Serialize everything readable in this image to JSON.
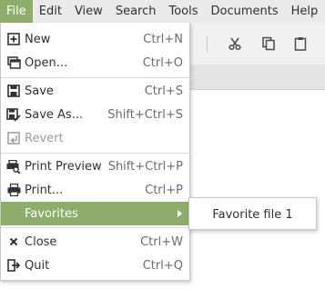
{
  "menubar": {
    "items": [
      {
        "label": "File",
        "active": true
      },
      {
        "label": "Edit"
      },
      {
        "label": "View"
      },
      {
        "label": "Search"
      },
      {
        "label": "Tools"
      },
      {
        "label": "Documents"
      },
      {
        "label": "Help"
      }
    ]
  },
  "toolbar": {
    "icons": [
      "cut-icon",
      "copy-icon",
      "paste-icon"
    ]
  },
  "file_menu": {
    "items": [
      {
        "label": "New",
        "accel": "Ctrl+N",
        "icon": "new-document-icon"
      },
      {
        "label": "Open...",
        "accel": "Ctrl+O",
        "icon": "open-icon"
      },
      {
        "label": "Save",
        "accel": "Ctrl+S",
        "icon": "save-icon"
      },
      {
        "label": "Save As...",
        "accel": "Shift+Ctrl+S",
        "icon": "save-as-icon"
      },
      {
        "label": "Revert",
        "accel": "",
        "icon": "revert-icon",
        "disabled": true
      },
      {
        "label": "Print Preview",
        "accel": "Shift+Ctrl+P",
        "icon": "print-preview-icon"
      },
      {
        "label": "Print...",
        "accel": "Ctrl+P",
        "icon": "print-icon"
      },
      {
        "label": "Favorites",
        "accel": "",
        "submenu": true,
        "highlighted": true
      },
      {
        "label": "Close",
        "accel": "Ctrl+W",
        "icon": "close-icon"
      },
      {
        "label": "Quit",
        "accel": "Ctrl+Q",
        "icon": "quit-icon"
      }
    ]
  },
  "favorites_submenu": {
    "items": [
      {
        "label": "Favorite file 1"
      }
    ]
  },
  "colors": {
    "accent": "#8fad6a",
    "menubar_bg": "#eaeaea",
    "disabled_text": "#9b9b9b"
  }
}
